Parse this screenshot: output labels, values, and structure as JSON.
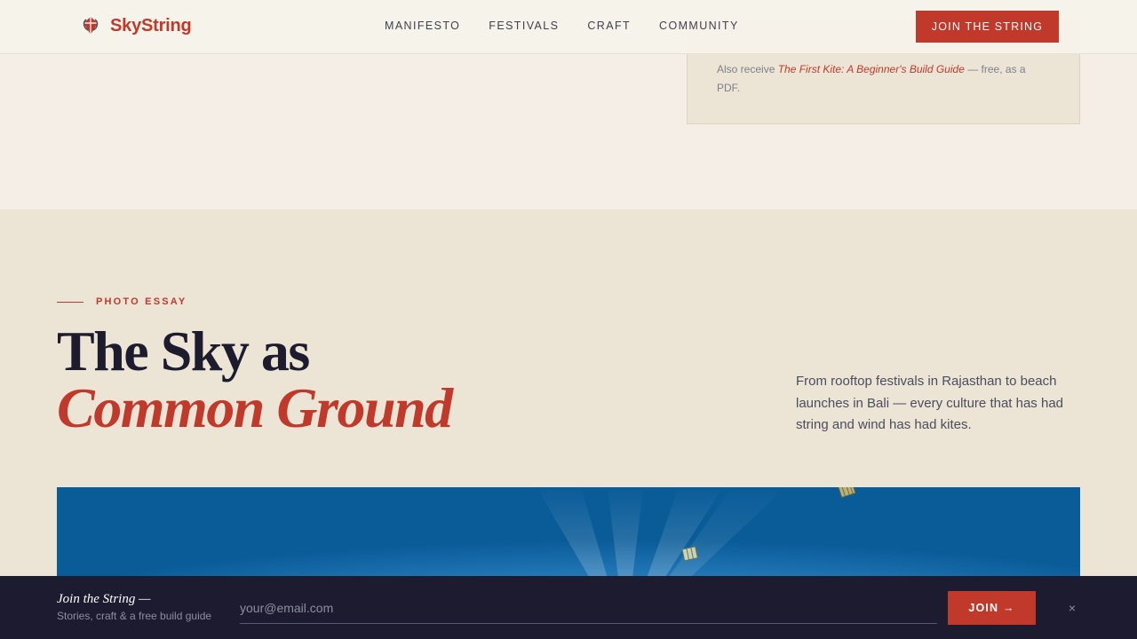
{
  "nav": {
    "brand": "SkyString",
    "brand_icon": "kite-logo-icon",
    "links": [
      "MANIFESTO",
      "FESTIVALS",
      "CRAFT",
      "COMMUNITY"
    ],
    "cta": "JOIN THE STRING"
  },
  "signup_card": {
    "note_prefix": "Also receive ",
    "note_link": "The First Kite: A Beginner's Build Guide",
    "note_suffix": " — free, as a PDF."
  },
  "essay": {
    "eyebrow": "PHOTO ESSAY",
    "headline_line1": "The Sky as",
    "headline_line2": "Common Ground",
    "lede": "From rooftop festivals in Rajasthan to beach launches in Bali — every culture that has had string and wind has had kites."
  },
  "bottom_bar": {
    "title": "Join the String —",
    "subtitle": "Stories, craft & a free build guide",
    "email_placeholder": "your@email.com",
    "join_label": "JOIN →",
    "close_label": "×"
  },
  "colors": {
    "accent": "#c0392b",
    "ink": "#1c1c2e",
    "page_bg": "#f5eee7",
    "section_bg": "#ece5d6",
    "bar_bg": "#1d1b30",
    "sky": "#1c76b6"
  }
}
